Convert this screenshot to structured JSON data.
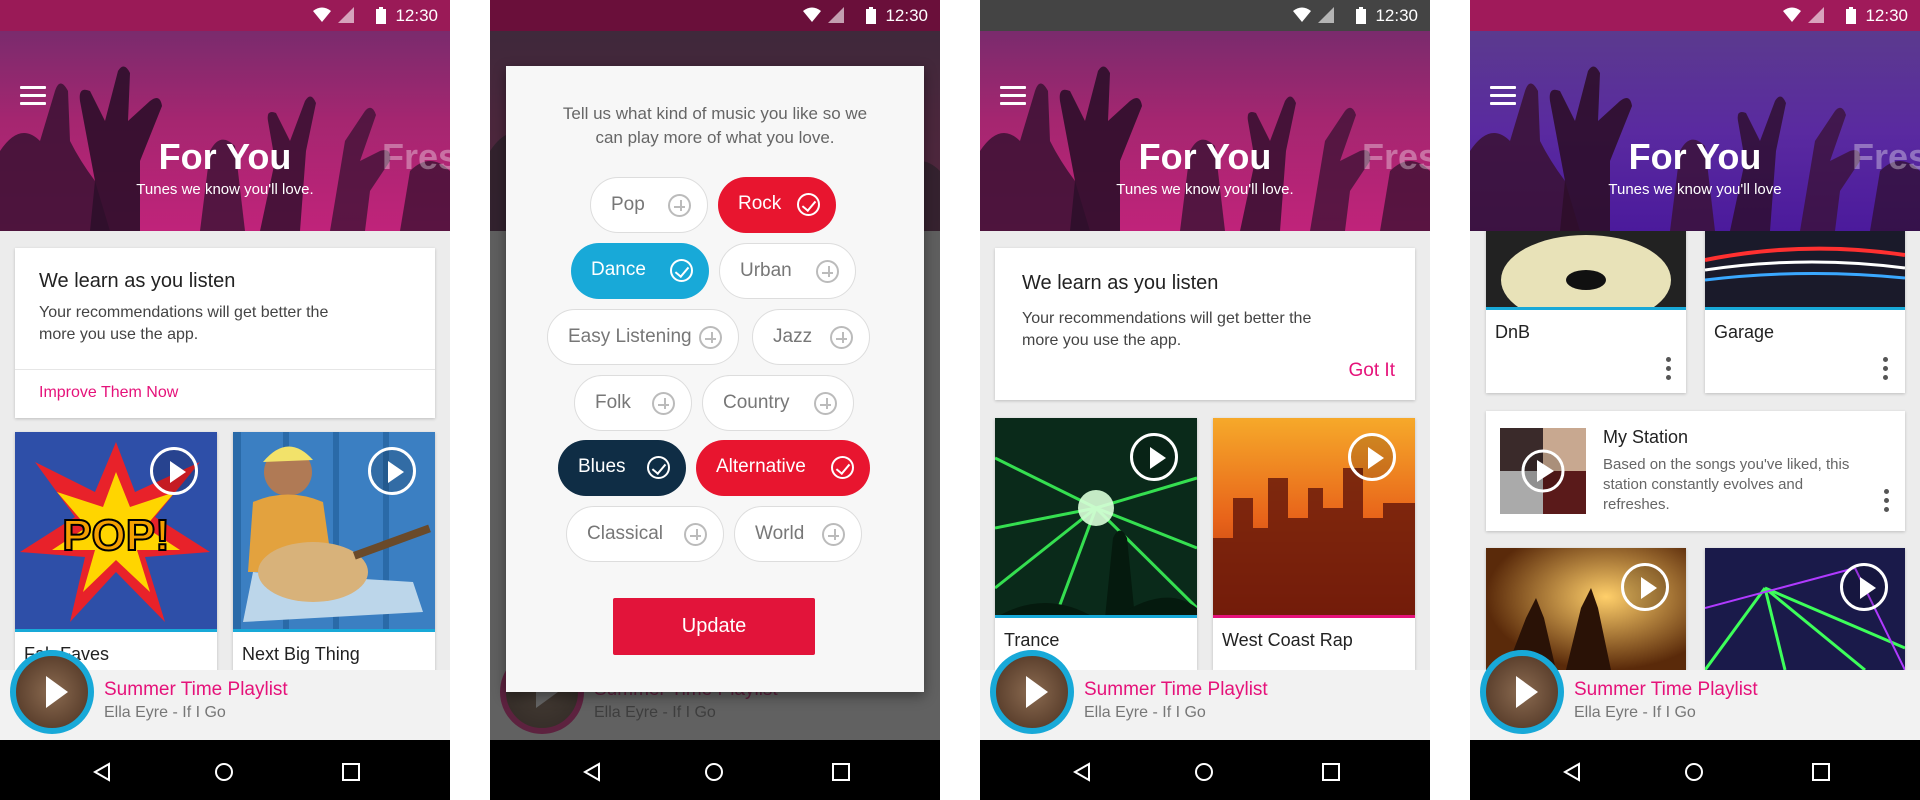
{
  "status": {
    "time": "12:30"
  },
  "colors": {
    "accent": "#e5127a",
    "play_ring": "#18a9d8",
    "rock": "#e8152f",
    "dance": "#18a9d8",
    "blues": "#0f2d45",
    "alternative": "#e8152f",
    "update": "#e2143a"
  },
  "icons": {
    "menu": "hamburger-menu-icon",
    "wifi": "wifi-icon",
    "signal": "signal-icon",
    "battery": "battery-icon",
    "back": "nav-back-icon",
    "home": "nav-home-icon",
    "recents": "nav-recents-icon",
    "play": "play-icon",
    "more": "more-vert-icon",
    "add": "plus-circle-icon",
    "check": "check-circle-icon"
  },
  "hero": {
    "title": "For You",
    "subtitle": "Tunes we know you'll love.",
    "subtitle_alt": "Tunes we know you'll love",
    "next_tab_peek": "Fres"
  },
  "learn_card": {
    "title": "We learn as you listen",
    "body": "Your recommendations will get better the more you use the app.",
    "link": "Improve Them Now",
    "got_it": "Got It"
  },
  "screen1": {
    "tiles": [
      "Fab Faves",
      "Next Big Thing"
    ]
  },
  "screen3": {
    "tiles": [
      "Trance",
      "West Coast Rap"
    ]
  },
  "screen4": {
    "tiles": [
      "DnB",
      "Garage"
    ],
    "station": {
      "title": "My Station",
      "body": "Based on the songs you've liked, this station constantly evolves and refreshes."
    }
  },
  "dialog": {
    "intro": "Tell us what kind of music you like so we can play more of what you love.",
    "genres": [
      {
        "label": "Pop",
        "selected": false
      },
      {
        "label": "Rock",
        "selected": true
      },
      {
        "label": "Dance",
        "selected": true
      },
      {
        "label": "Urban",
        "selected": false
      },
      {
        "label": "Easy Listening",
        "selected": false
      },
      {
        "label": "Jazz",
        "selected": false
      },
      {
        "label": "Folk",
        "selected": false
      },
      {
        "label": "Country",
        "selected": false
      },
      {
        "label": "Blues",
        "selected": true
      },
      {
        "label": "Alternative",
        "selected": true
      },
      {
        "label": "Classical",
        "selected": false
      },
      {
        "label": "World",
        "selected": false
      }
    ],
    "update": "Update"
  },
  "player": {
    "title": "Summer Time Playlist",
    "subtitle": "Ella Eyre - If I Go"
  }
}
